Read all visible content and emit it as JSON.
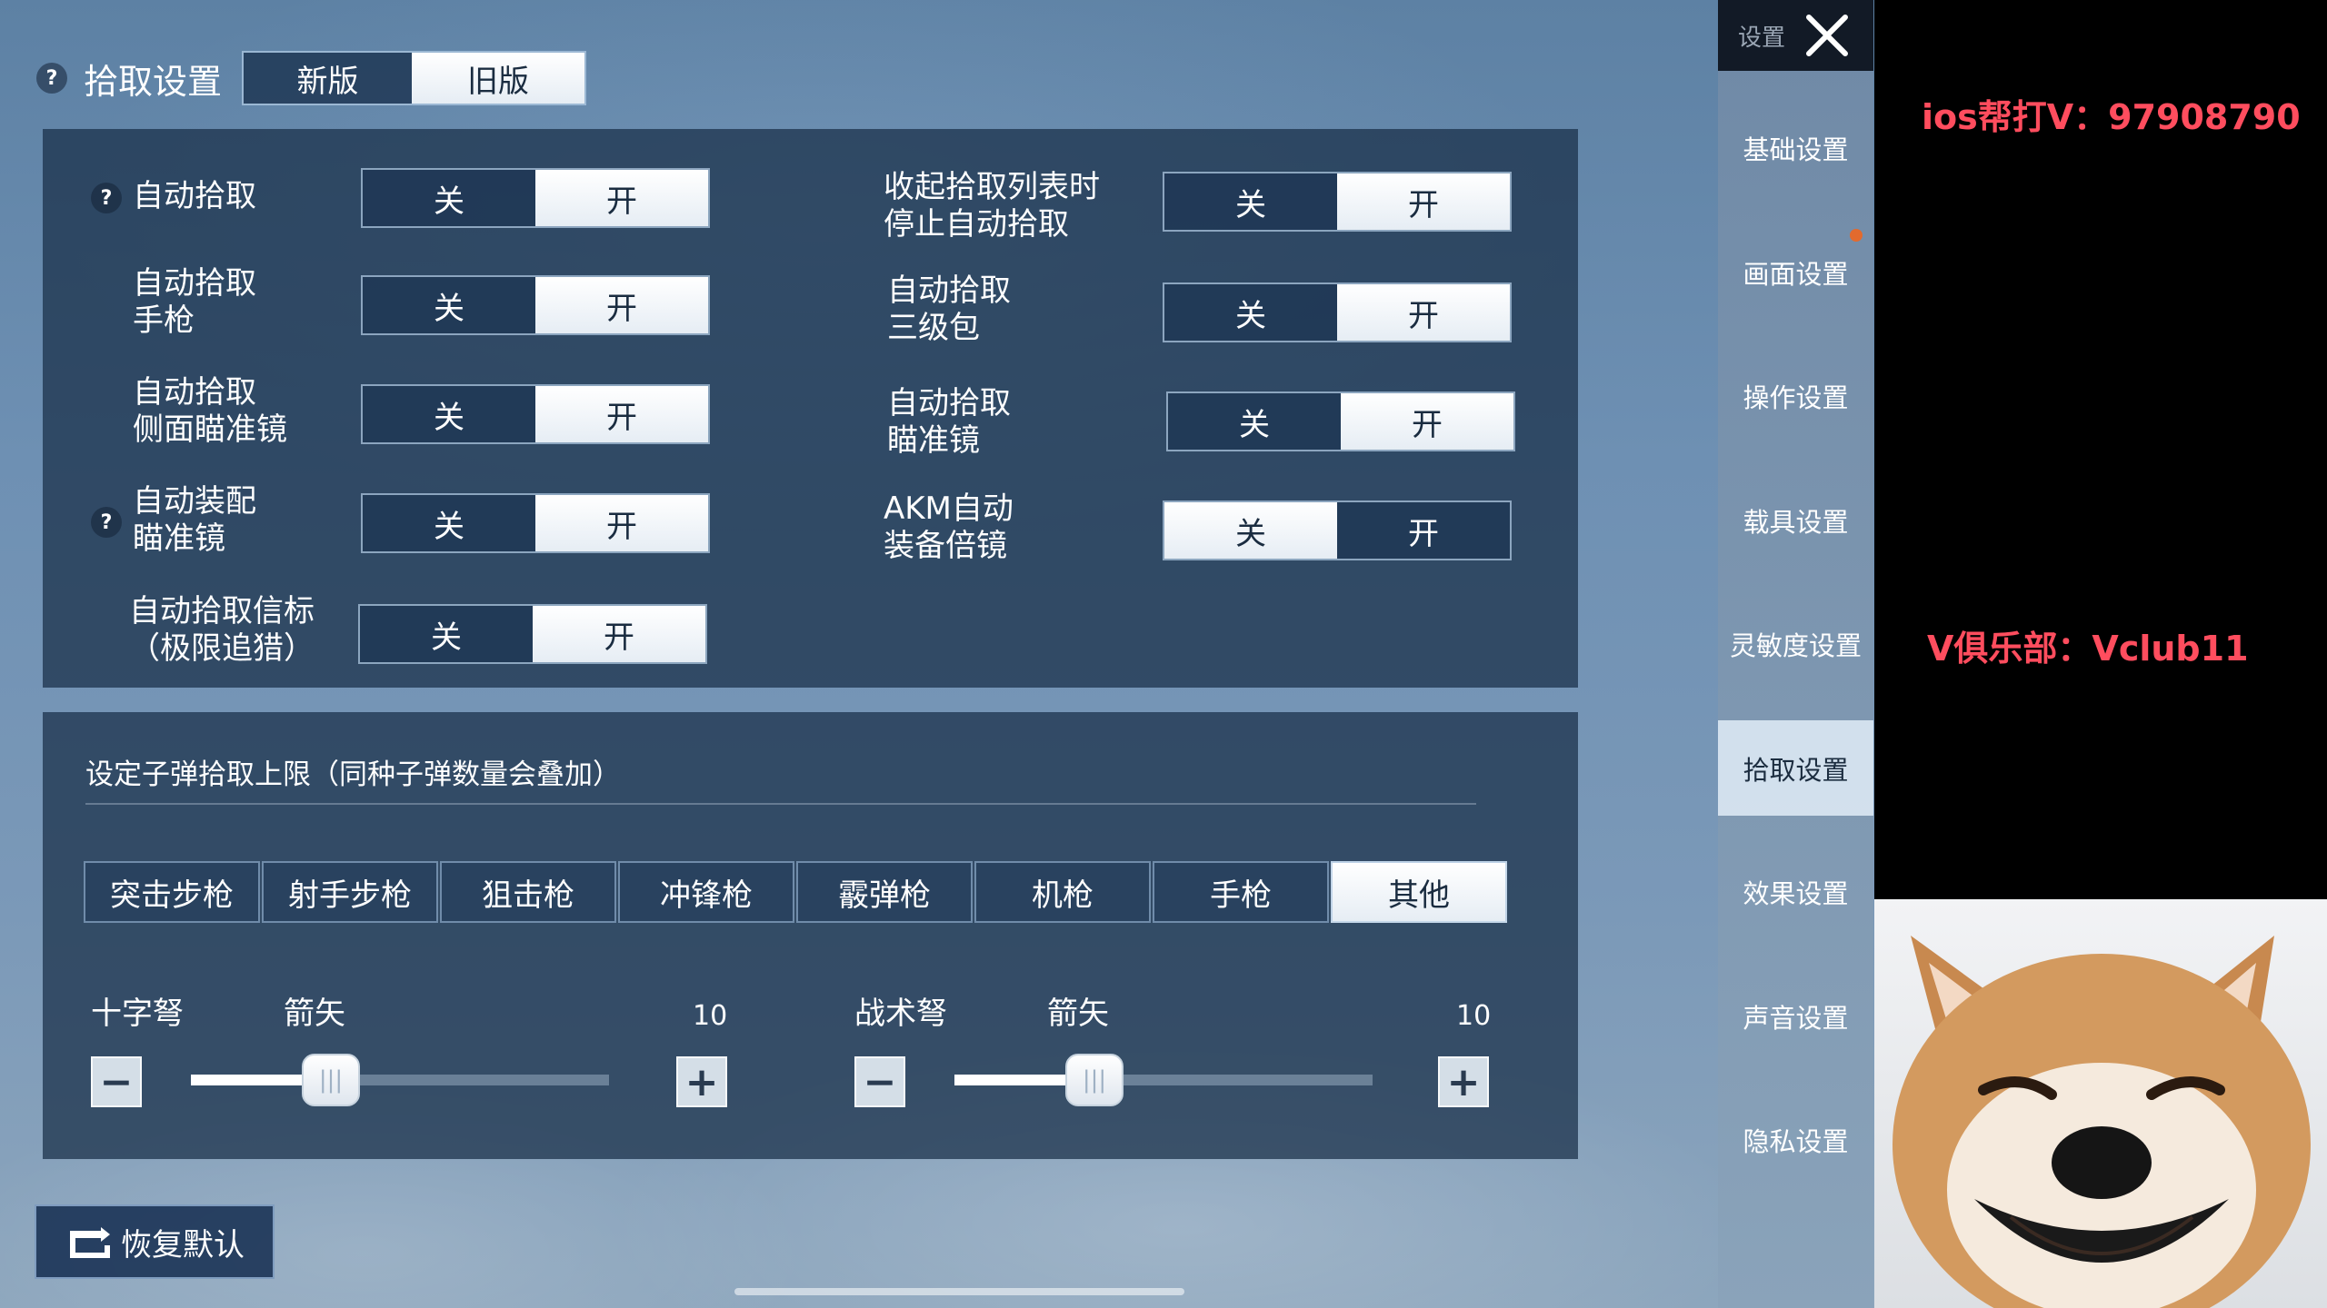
{
  "header": {
    "title": "拾取设置",
    "version_tabs": [
      "新版",
      "旧版"
    ],
    "active_version": "旧版"
  },
  "toggle_labels": {
    "off": "关",
    "on": "开"
  },
  "left_settings": [
    {
      "label": "自动拾取",
      "help": true,
      "state": "开"
    },
    {
      "label": "自动拾取\n手枪",
      "help": false,
      "state": "开"
    },
    {
      "label": "自动拾取\n侧面瞄准镜",
      "help": false,
      "state": "开"
    },
    {
      "label": "自动装配\n瞄准镜",
      "help": true,
      "state": "开"
    },
    {
      "label": "自动拾取信标\n（极限追猎）",
      "help": false,
      "state": "开"
    }
  ],
  "right_settings": [
    {
      "label": "收起拾取列表时\n停止自动拾取",
      "state": "开"
    },
    {
      "label": "自动拾取\n三级包",
      "state": "开"
    },
    {
      "label": "自动拾取\n瞄准镜",
      "state": "开"
    },
    {
      "label": "AKM自动\n装备倍镜",
      "state": "关"
    }
  ],
  "ammo_section": {
    "title": "设定子弹拾取上限（同种子弹数量会叠加）",
    "weapon_tabs": [
      "突击步枪",
      "射手步枪",
      "狙击枪",
      "冲锋枪",
      "霰弹枪",
      "机枪",
      "手枪",
      "其他"
    ],
    "active_tab": "其他",
    "sliders": [
      {
        "weapon": "十字弩",
        "ammo": "箭矢",
        "value": "10",
        "fill_fraction": 0.33
      },
      {
        "weapon": "战术弩",
        "ammo": "箭矢",
        "value": "10",
        "fill_fraction": 0.33
      }
    ]
  },
  "reset_button": "恢复默认",
  "sidebar": {
    "header": "设置",
    "items": [
      "基础设置",
      "画面设置",
      "操作设置",
      "载具设置",
      "灵敏度设置",
      "拾取设置",
      "效果设置",
      "声音设置",
      "隐私设置"
    ],
    "active": "拾取设置"
  },
  "overlay": {
    "promo_top": "ios帮打V：97908790",
    "promo_mid": "V俱乐部：Vclub11"
  },
  "colors": {
    "accent_promo": "#ff4d5e",
    "notification_dot": "#e26a2e"
  }
}
